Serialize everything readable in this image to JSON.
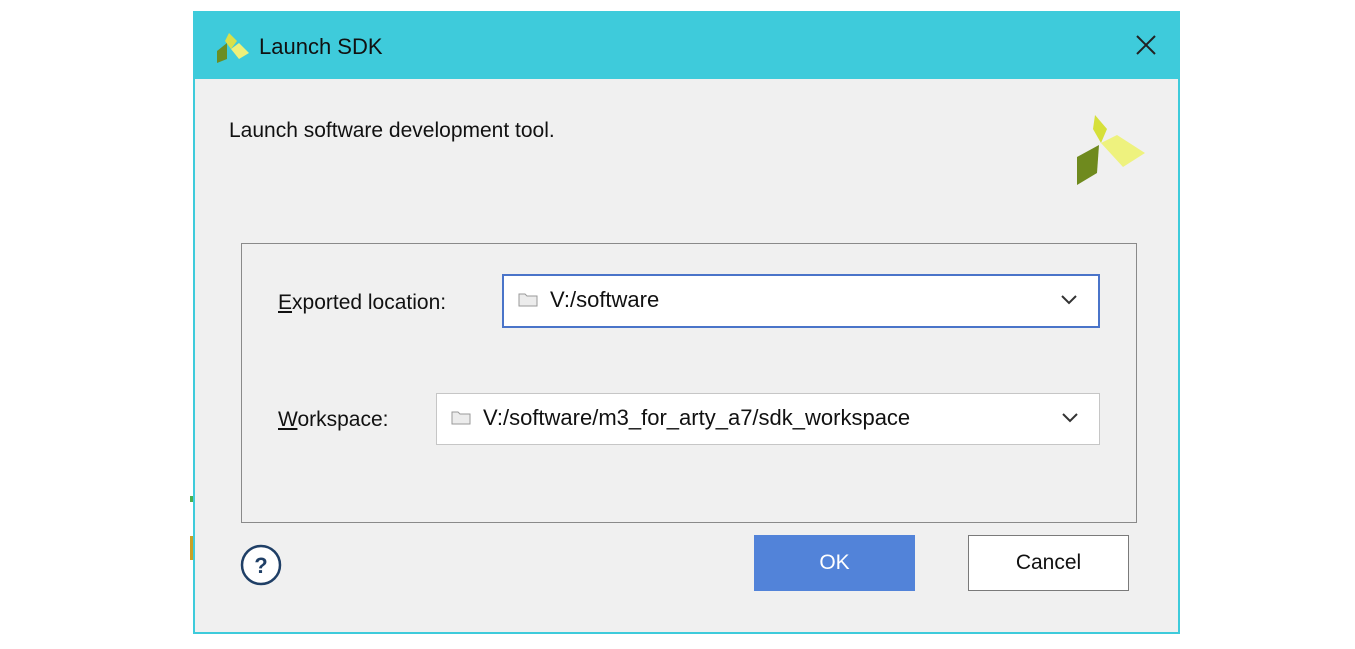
{
  "window": {
    "title": "Launch SDK",
    "icon": "xilinx-logo-icon",
    "close_icon": "close-icon",
    "accent_color": "#3ecbdb"
  },
  "content": {
    "description": "Launch software development tool.",
    "logo": "xilinx-logo"
  },
  "form": {
    "exported_location": {
      "label_mnemonic": "E",
      "label_rest": "xported location:",
      "value": "V:/software",
      "icon": "folder-icon"
    },
    "workspace": {
      "label_mnemonic": "W",
      "label_rest": "orkspace:",
      "value": "V:/software/m3_for_arty_a7/sdk_workspace",
      "icon": "folder-icon"
    }
  },
  "footer": {
    "help_label": "?",
    "ok_label": "OK",
    "cancel_label": "Cancel",
    "ok_color": "#5283d9"
  }
}
